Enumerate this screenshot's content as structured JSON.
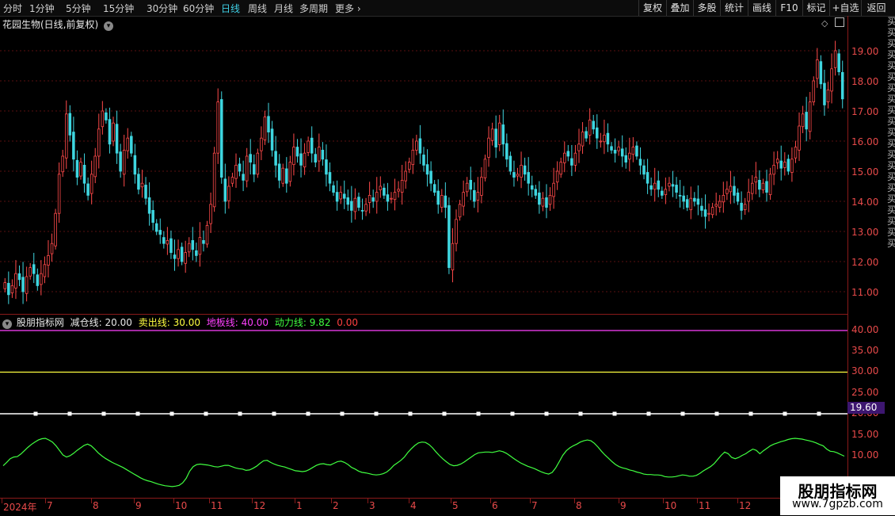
{
  "toolbar": {
    "timeframes": [
      "分时",
      "1分钟",
      "5分钟",
      "15分钟",
      "30分钟",
      "60分钟",
      "日线",
      "周线",
      "月线",
      "多周期",
      "更多"
    ],
    "active_timeframe": "日线",
    "right_buttons": [
      "复权",
      "叠加",
      "多股",
      "统计",
      "画线",
      "F10",
      "标记",
      "+自选",
      "返回"
    ]
  },
  "chart_header": {
    "title": "花园生物(日线,前复权)"
  },
  "indicator": {
    "name": "股朋指标网",
    "lines": [
      {
        "label": "减仓线:",
        "value": "20.00",
        "color": "#e8e8e8"
      },
      {
        "label": "卖出线:",
        "value": "30.00",
        "color": "#ffff40"
      },
      {
        "label": "地板线:",
        "value": "40.00",
        "color": "#ff40ff"
      },
      {
        "label": "动力线:",
        "value": "9.82",
        "color": "#40ff40"
      },
      {
        "label": "",
        "value": "0.00",
        "color": "#ff4040"
      }
    ]
  },
  "price_axis": [
    "19.00",
    "18.00",
    "17.00",
    "16.00",
    "15.00",
    "14.00",
    "13.00",
    "12.00",
    "11.00"
  ],
  "indicator_axis": [
    "40.00",
    "35.00",
    "30.00",
    "25.00",
    "20.00",
    "15.00",
    "10.00"
  ],
  "current_tag": "19.60",
  "x_axis": [
    "2024年",
    "7",
    "8",
    "9",
    "10",
    "11",
    "12",
    "1",
    "2",
    "3",
    "4",
    "5",
    "6",
    "7",
    "8",
    "9",
    "10",
    "11",
    "12"
  ],
  "right_strip": "买买买买买买买买买买买买买买买买买买买买买",
  "watermark": {
    "title": "股朋指标网",
    "url": "www.7gpzb.com"
  },
  "colors": {
    "up": "#ff4a4a",
    "down": "#3fd6e0",
    "grid": "#5a1010",
    "momentum": "#40ff40",
    "sell": "#ffff40",
    "floor": "#ff40ff",
    "reduce": "#ffffff"
  },
  "chart_data": {
    "type": "candlestick",
    "title": "花园生物(日线,前复权)",
    "ylim": [
      10.6,
      19.9
    ],
    "close": [
      11.3,
      10.9,
      11.2,
      11.6,
      11.4,
      11.0,
      11.5,
      11.8,
      11.6,
      11.2,
      11.6,
      11.9,
      12.2,
      12.6,
      13.6,
      14.9,
      15.5,
      16.9,
      16.2,
      15.4,
      14.8,
      15.3,
      14.6,
      14.2,
      14.9,
      15.5,
      16.4,
      17.0,
      16.7,
      15.9,
      16.6,
      15.6,
      15.0,
      15.7,
      16.1,
      15.6,
      14.9,
      14.4,
      14.6,
      14.1,
      13.6,
      13.3,
      13.0,
      12.9,
      12.6,
      12.7,
      12.3,
      12.1,
      12.4,
      12.0,
      12.3,
      12.6,
      12.4,
      12.2,
      12.8,
      12.6,
      13.2,
      13.9,
      15.6,
      17.3,
      14.8,
      14.0,
      14.5,
      14.8,
      15.2,
      15.0,
      14.7,
      15.5,
      15.3,
      14.9,
      15.6,
      16.1,
      16.8,
      16.3,
      15.7,
      15.2,
      14.7,
      15.1,
      14.6,
      15.3,
      15.8,
      15.5,
      15.2,
      15.6,
      16.0,
      15.6,
      15.3,
      15.8,
      15.4,
      14.9,
      14.6,
      14.3,
      14.0,
      14.3,
      14.1,
      13.9,
      13.7,
      14.1,
      13.8,
      13.7,
      13.9,
      14.2,
      14.0,
      14.3,
      14.5,
      14.2,
      14.0,
      14.1,
      14.3,
      14.4,
      14.7,
      15.0,
      15.3,
      15.7,
      16.0,
      15.6,
      15.2,
      14.9,
      14.6,
      14.3,
      13.9,
      14.2,
      13.8,
      11.8,
      12.6,
      13.4,
      13.9,
      14.3,
      14.6,
      14.4,
      14.0,
      14.3,
      14.8,
      15.4,
      16.1,
      16.4,
      15.8,
      16.6,
      15.9,
      15.4,
      15.0,
      14.8,
      14.9,
      15.2,
      14.9,
      14.6,
      14.4,
      14.2,
      13.9,
      14.1,
      13.8,
      14.2,
      14.6,
      15.0,
      15.3,
      15.6,
      15.5,
      15.2,
      15.6,
      15.9,
      16.3,
      16.1,
      16.7,
      16.4,
      16.1,
      16.0,
      16.2,
      15.9,
      15.7,
      15.6,
      15.8,
      15.5,
      15.3,
      15.6,
      15.8,
      15.5,
      15.2,
      14.9,
      14.6,
      14.4,
      14.6,
      14.4,
      14.2,
      14.4,
      14.6,
      14.5,
      14.3,
      14.2,
      14.0,
      13.8,
      14.1,
      14.0,
      13.9,
      13.7,
      13.5,
      13.6,
      13.8,
      13.9,
      14.0,
      14.2,
      14.4,
      14.5,
      14.2,
      14.0,
      13.7,
      13.9,
      14.3,
      14.6,
      14.8,
      14.4,
      14.6,
      14.3,
      14.9,
      15.2,
      15.4,
      15.1,
      15.3,
      15.0,
      15.4,
      15.8,
      16.5,
      16.9,
      16.4,
      17.3,
      18.0,
      18.7,
      17.9,
      17.2,
      17.7,
      18.4,
      19.0,
      18.3,
      17.4
    ],
    "indicator_lines": [
      {
        "name": "减仓线",
        "value": 20.0
      },
      {
        "name": "卖出线",
        "value": 30.0
      },
      {
        "name": "地板线",
        "value": 40.0
      }
    ],
    "momentum": [
      7.5,
      8.3,
      9.2,
      9.6,
      9.7,
      10.3,
      11.1,
      11.9,
      12.6,
      13.2,
      13.7,
      14.0,
      14.1,
      13.7,
      13.2,
      12.3,
      11.2,
      10.1,
      9.6,
      9.9,
      10.5,
      11.2,
      11.8,
      12.4,
      12.7,
      12.3,
      11.5,
      10.6,
      9.9,
      9.3,
      8.8,
      8.3,
      7.9,
      7.5,
      7.1,
      6.6,
      6.1,
      5.6,
      5.1,
      4.6,
      4.2,
      3.9,
      3.7,
      3.4,
      3.1,
      2.9,
      2.7,
      2.6,
      2.5,
      2.6,
      2.8,
      3.4,
      4.5,
      6.2,
      7.3,
      7.8,
      7.9,
      7.8,
      7.7,
      7.5,
      7.3,
      7.2,
      7.4,
      7.6,
      7.6,
      7.3,
      7.0,
      6.8,
      6.7,
      6.4,
      6.5,
      6.9,
      7.4,
      8.1,
      8.7,
      8.8,
      8.3,
      7.9,
      7.6,
      7.4,
      7.2,
      6.9,
      6.6,
      6.3,
      6.2,
      6.1,
      6.2,
      6.6,
      7.1,
      7.6,
      7.9,
      8.0,
      7.8,
      7.7,
      8.1,
      8.5,
      8.6,
      8.3,
      7.8,
      7.1,
      6.7,
      6.2,
      5.9,
      5.8,
      5.6,
      5.4,
      5.3,
      5.4,
      5.6,
      6.0,
      6.7,
      7.6,
      8.2,
      8.8,
      9.6,
      10.7,
      11.6,
      12.4,
      13.0,
      13.2,
      13.1,
      12.6,
      11.8,
      10.8,
      9.9,
      9.1,
      8.4,
      7.8,
      7.5,
      7.6,
      7.9,
      8.4,
      9.0,
      9.6,
      10.2,
      10.6,
      10.7,
      10.8,
      10.8,
      10.7,
      10.9,
      11.1,
      10.9,
      10.5,
      9.9,
      9.3,
      8.7,
      8.2,
      7.8,
      7.4,
      7.1,
      6.8,
      6.4,
      6.0,
      5.7,
      5.5,
      5.9,
      7.0,
      8.5,
      10.0,
      11.1,
      11.8,
      12.3,
      12.7,
      13.2,
      13.5,
      13.7,
      13.5,
      12.9,
      12.0,
      11.0,
      10.1,
      9.3,
      8.5,
      7.8,
      7.3,
      7.0,
      6.8,
      6.5,
      6.3,
      6.0,
      5.8,
      5.5,
      5.4,
      5.4,
      5.3,
      5.3,
      5.2,
      4.9,
      4.8,
      4.8,
      4.9,
      5.1,
      5.3,
      5.2,
      5.0,
      5.0,
      5.2,
      5.7,
      6.3,
      6.8,
      7.3,
      8.0,
      9.0,
      10.0,
      10.8,
      10.4,
      9.5,
      9.2,
      9.5,
      10.0,
      10.4,
      11.0,
      11.5,
      11.2,
      10.4,
      11.1,
      11.7,
      12.3,
      12.7,
      13.0,
      13.3,
      13.5,
      13.8,
      14.0,
      14.1,
      14.0,
      13.9,
      13.7,
      13.5,
      13.3,
      13.0,
      12.6,
      12.3,
      11.5,
      11.0,
      10.9,
      10.6,
      10.2,
      9.8
    ]
  }
}
